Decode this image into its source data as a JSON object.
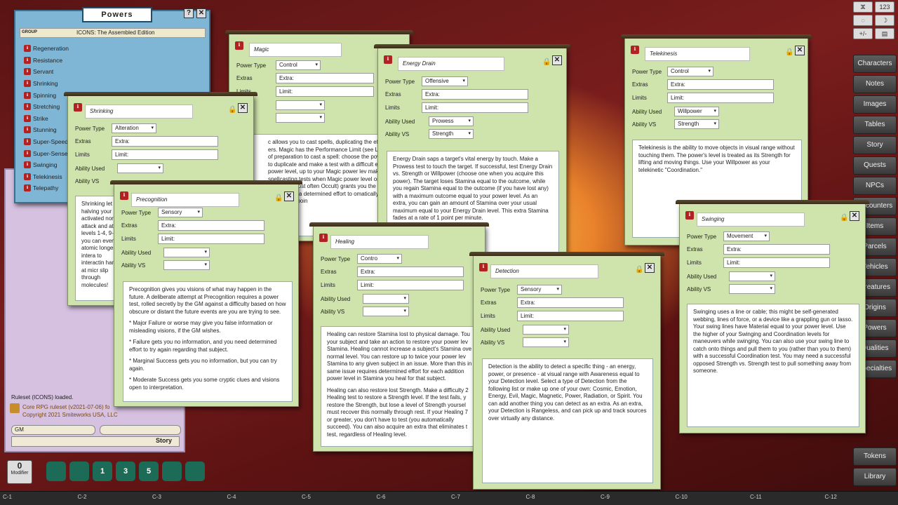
{
  "powers_window": {
    "title": "Powers",
    "group_label": "GROUP",
    "group_value": "ICONS: The Assembled Edition",
    "items": [
      "Regeneration",
      "Resistance",
      "Servant",
      "Shrinking",
      "Spinning",
      "Stretching",
      "Strike",
      "Stunning",
      "Super-Speed",
      "Super-Sense",
      "Swinging",
      "Telekinesis",
      "Telepathy"
    ]
  },
  "chat": {
    "ruleset_loaded": "Ruleset (ICONS) loaded.",
    "core_version": "Core RPG ruleset (v2021-07-06) fo",
    "copyright": "Copyright 2021 Smiteworks USA, LLC",
    "identity": "GM",
    "story_button": "Story"
  },
  "field_labels": {
    "power_type": "Power Type",
    "extras": "Extras",
    "limits": "Limits",
    "ability_used": "Ability Used",
    "ability_vs": "Ability VS",
    "extra_ph": "Extra:",
    "limit_ph": "Limit:"
  },
  "magic": {
    "title": "Magic",
    "power_type": "Control",
    "description": "c allows you to cast spells, duplicating the effect ers. Magic has the Performance Limit (see Limit e of preparation to cast a spell: choose the pow wish to duplicate and make a test with a difficult esired power level, up to your Magic power lev make spellcasting tests when Magic power level or an attr specialty (most often Occult) grants you the power at tha make a determined effort to omatically by spending a poin"
  },
  "energy_drain": {
    "title": "Energy Drain",
    "power_type": "Offensive",
    "ability_used": "Prowess",
    "ability_vs": "Strength",
    "description": "Energy Drain saps a target's vital energy by touch. Make a Prowess test to touch the target. If successful, test Energy Drain vs. Strength or Willpower (choose one when you acquire this power). The target loses Stamina equal to the outcome, while you regain Stamina equal to the outcome (if you have lost any) with a maximum outcome equal to your power level. As an extra, you can gain an amount of Stamina over your usual maximum equal to your Energy Drain level. This extra Stamina fades at a rate of 1 point per minute."
  },
  "telekinesis": {
    "title": "Telekinesis",
    "power_type": "Control",
    "ability_used": "Willpower",
    "ability_vs": "Strength",
    "description": "Telekinesis is the ability to move objects in visual range without touching them. The power's level is treated as its Strength for lifting and moving things. Use your Willpower as your telekinetic \"Coordination.\""
  },
  "shrinking": {
    "title": "Shrinking",
    "power_type": "Alteration",
    "description": "Shrinking let halving your activated nor to attack and at levels 1-4, 9-10, you can even atomic longer intera to interactin hand, at micr slip through molecules!"
  },
  "precognition": {
    "title": "Precognition",
    "power_type": "Sensory",
    "description": [
      "Precognition gives you visions of what may happen in the future. A deliberate attempt at Precognition requires a power test, rolled secretly by the GM against a difficulty based on how obscure or distant the future events are you are trying to see.",
      "* Major Failure or worse may give you false information or misleading visions, if the GM wishes.",
      "* Failure gets you no information, and you need determined effort to try again regarding that subject.",
      "* Marginal Success gets you no information, but you can try again.",
      "* Moderate Success gets you some cryptic clues and visions open to interpretation."
    ]
  },
  "healing": {
    "title": "Healing",
    "power_type": "Contro",
    "description": [
      "Healing can restore Stamina lost to physical damage. Tou your subject and take an action to restore your power lev Stamina. Healing cannot increase a subject's Stamina ove normal level. You can restore up to twice your power lev Stamina to any given subject in an issue. More than this in same issue requires determined effort for each addition power level in Stamina you heal for that subject.",
      "Healing can also restore lost Strength. Make a difficulty 2 Healing test to restore a Strength level. If the test fails, y restore the Strength, but lose a level of Strength yoursel must recover this normally through rest. If your Healing 7 or greater, you don't have to test (you automatically succeed). You can also acquire an extra that eliminates t test, regardless of Healing level."
    ]
  },
  "detection": {
    "title": "Detection",
    "power_type": "Sensory",
    "description": "Detection is the ability to detect a specific thing - an energy, power, or presence - at visual range with Awareness equal to your Detection level. Select a type of Detection from the following list or make up one of your own: Cosmic, Emotion, Energy, Evil, Magic, Magnetic, Power, Radiation, or Spirit. You can add another thing you can detect as an extra. As an extra, your Detection is Rangeless, and can pick up and track sources over virtually any distance."
  },
  "swinging": {
    "title": "Swinging",
    "power_type": "Movement",
    "description": "Swinging uses a line or cable; this might be self-generated webbing, lines of force, or a device like a grappling gun or lasso. Your swing lines have Material equal to your power level. Use the higher of your Swinging and Coordination levels for maneuvers while swinging. You can also use your swing line to catch onto things and pull them to you (rather than you to them) with a successful Coordination test. You may need a successful opposed Strength vs. Strength test to pull something away from someone."
  },
  "sidebar": [
    "Characters",
    "Notes",
    "Images",
    "Tables",
    "Story",
    "Quests",
    "NPCs",
    "Encounters",
    "Items",
    "Parcels",
    "Vehicles",
    "Creatures",
    "Origins",
    "Powers",
    "Qualities",
    "Specialties"
  ],
  "sidebar_bottom": [
    "Tokens",
    "Library"
  ],
  "top_icons": [
    "ⵣ",
    "123",
    "◌",
    "☽",
    "+/-",
    "▤"
  ],
  "modifier": {
    "value": "0",
    "label": "Modifier"
  },
  "dice": [
    "d4",
    "d6",
    "d8",
    "d10",
    "d12",
    "d20",
    "d+"
  ],
  "dice_labels": [
    "",
    "",
    "1",
    "3",
    "5",
    "",
    ""
  ],
  "hotkeys": [
    "C-1",
    "C-2",
    "C-3",
    "C-4",
    "C-5",
    "C-6",
    "C-7",
    "C-8",
    "C-9",
    "C-10",
    "C-11",
    "C-12"
  ]
}
